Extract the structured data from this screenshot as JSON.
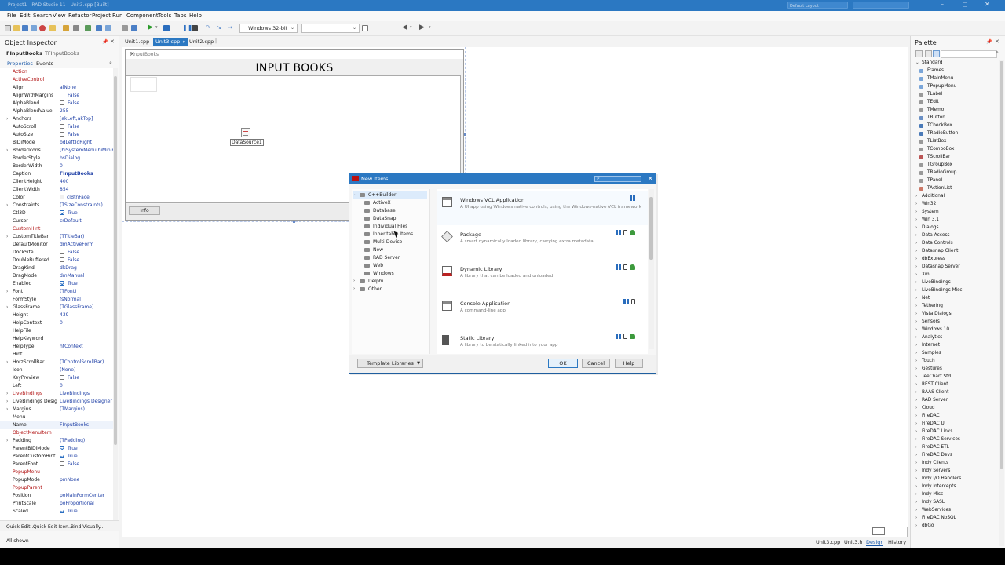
{
  "window": {
    "title": "Project1 - RAD Studio 11 - Unit3.cpp [Built]",
    "search_box": "Default Layout",
    "search2": ""
  },
  "menu": [
    "File",
    "Edit",
    "Search",
    "View",
    "Refactor",
    "Project",
    "Run",
    "Component",
    "Tools",
    "Tabs",
    "Help"
  ],
  "toolbar": {
    "platform": "Windows 32-bit",
    "config": ""
  },
  "object_inspector": {
    "title": "Object Inspector",
    "object_name": "FInputBooks",
    "object_type": "TFInputBooks",
    "tabs": [
      "Properties",
      "Events"
    ],
    "properties": [
      {
        "n": "Action",
        "v": "",
        "hl": true
      },
      {
        "n": "ActiveControl",
        "v": "",
        "hl": true
      },
      {
        "n": "Align",
        "v": "alNone"
      },
      {
        "n": "AlignWithMargins",
        "cb": false,
        "v": "False"
      },
      {
        "n": "AlphaBlend",
        "cb": false,
        "v": "False"
      },
      {
        "n": "AlphaBlendValue",
        "v": "255"
      },
      {
        "n": "Anchors",
        "v": "[akLeft,akTop]",
        "exp": true
      },
      {
        "n": "AutoScroll",
        "cb": false,
        "v": "False"
      },
      {
        "n": "AutoSize",
        "cb": false,
        "v": "False"
      },
      {
        "n": "BiDiMode",
        "v": "bdLeftToRight"
      },
      {
        "n": "BorderIcons",
        "v": "[biSystemMenu,biMinim",
        "exp": true
      },
      {
        "n": "BorderStyle",
        "v": "bsDialog"
      },
      {
        "n": "BorderWidth",
        "v": "0"
      },
      {
        "n": "Caption",
        "v": "FInputBooks",
        "b": true
      },
      {
        "n": "ClientHeight",
        "v": "400"
      },
      {
        "n": "ClientWidth",
        "v": "854"
      },
      {
        "n": "Color",
        "v": "clBtnFace",
        "sw": true
      },
      {
        "n": "Constraints",
        "v": "(TSizeConstraints)",
        "exp": true
      },
      {
        "n": "Ctl3D",
        "cb": true,
        "v": "True"
      },
      {
        "n": "Cursor",
        "v": "crDefault"
      },
      {
        "n": "CustomHint",
        "v": "",
        "hl": true
      },
      {
        "n": "CustomTitleBar",
        "v": "(TTitleBar)",
        "exp": true
      },
      {
        "n": "DefaultMonitor",
        "v": "dmActiveForm"
      },
      {
        "n": "DockSite",
        "cb": false,
        "v": "False"
      },
      {
        "n": "DoubleBuffered",
        "cb": false,
        "v": "False"
      },
      {
        "n": "DragKind",
        "v": "dkDrag"
      },
      {
        "n": "DragMode",
        "v": "dmManual"
      },
      {
        "n": "Enabled",
        "cb": true,
        "v": "True"
      },
      {
        "n": "Font",
        "v": "(TFont)",
        "exp": true
      },
      {
        "n": "FormStyle",
        "v": "fsNormal"
      },
      {
        "n": "GlassFrame",
        "v": "(TGlassFrame)",
        "exp": true
      },
      {
        "n": "Height",
        "v": "439"
      },
      {
        "n": "HelpContext",
        "v": "0"
      },
      {
        "n": "HelpFile",
        "v": ""
      },
      {
        "n": "HelpKeyword",
        "v": ""
      },
      {
        "n": "HelpType",
        "v": "htContext"
      },
      {
        "n": "Hint",
        "v": ""
      },
      {
        "n": "HorzScrollBar",
        "v": "(TControlScrollBar)",
        "exp": true
      },
      {
        "n": "Icon",
        "v": "(None)"
      },
      {
        "n": "KeyPreview",
        "cb": false,
        "v": "False"
      },
      {
        "n": "Left",
        "v": "0"
      },
      {
        "n": "LiveBindings",
        "v": "LiveBindings",
        "hl": true,
        "exp": true
      },
      {
        "n": "LiveBindings Designe",
        "v": "LiveBindings Designer",
        "exp": true
      },
      {
        "n": "Margins",
        "v": "(TMargins)",
        "exp": true
      },
      {
        "n": "Menu",
        "v": ""
      },
      {
        "n": "Name",
        "v": "FInputBooks",
        "sel": true
      },
      {
        "n": "ObjectMenuItem",
        "v": "",
        "hl": true
      },
      {
        "n": "Padding",
        "v": "(TPadding)",
        "exp": true
      },
      {
        "n": "ParentBiDiMode",
        "cb": true,
        "v": "True"
      },
      {
        "n": "ParentCustomHint",
        "cb": true,
        "v": "True"
      },
      {
        "n": "ParentFont",
        "cb": false,
        "v": "False"
      },
      {
        "n": "PopupMenu",
        "v": "",
        "hl": true
      },
      {
        "n": "PopupMode",
        "v": "pmNone"
      },
      {
        "n": "PopupParent",
        "v": "",
        "hl": true
      },
      {
        "n": "Position",
        "v": "poMainFormCenter"
      },
      {
        "n": "PrintScale",
        "v": "poProportional"
      },
      {
        "n": "Scaled",
        "cb": true,
        "v": "True"
      }
    ],
    "footer_links": [
      "Quick Edit...",
      "Quick Edit Icon...",
      "Bind Visually..."
    ],
    "status": "All shown"
  },
  "editor": {
    "tabs": [
      "Unit1.cpp",
      "Unit3.cpp",
      "Unit2.cpp"
    ],
    "active_tab": 1,
    "form_caption": "FInputBooks",
    "heading": "INPUT BOOKS",
    "datasource": "DataSource1",
    "info_button": "Info",
    "bottom_tabs": [
      "Unit3.cpp",
      "Unit3.h",
      "Design",
      "History"
    ]
  },
  "palette": {
    "title": "Palette",
    "items": [
      {
        "t": "cat",
        "l": "Standard",
        "open": true
      },
      {
        "t": "comp",
        "l": "Frames",
        "c": "#7aa5d8"
      },
      {
        "t": "comp",
        "l": "TMainMenu",
        "c": "#7aa5d8"
      },
      {
        "t": "comp",
        "l": "TPopupMenu",
        "c": "#7aa5d8"
      },
      {
        "t": "comp",
        "l": "TLabel",
        "c": "#999"
      },
      {
        "t": "comp",
        "l": "TEdit",
        "c": "#999"
      },
      {
        "t": "comp",
        "l": "TMemo",
        "c": "#999"
      },
      {
        "t": "comp",
        "l": "TButton",
        "c": "#6a8fc4"
      },
      {
        "t": "comp",
        "l": "TCheckBox",
        "c": "#4a7ab8"
      },
      {
        "t": "comp",
        "l": "TRadioButton",
        "c": "#4a7ab8"
      },
      {
        "t": "comp",
        "l": "TListBox",
        "c": "#999"
      },
      {
        "t": "comp",
        "l": "TComboBox",
        "c": "#999"
      },
      {
        "t": "comp",
        "l": "TScrollBar",
        "c": "#b55"
      },
      {
        "t": "comp",
        "l": "TGroupBox",
        "c": "#999"
      },
      {
        "t": "comp",
        "l": "TRadioGroup",
        "c": "#999"
      },
      {
        "t": "comp",
        "l": "TPanel",
        "c": "#999"
      },
      {
        "t": "comp",
        "l": "TActionList",
        "c": "#c76"
      },
      {
        "t": "cat",
        "l": "Additional"
      },
      {
        "t": "cat",
        "l": "Win32"
      },
      {
        "t": "cat",
        "l": "System"
      },
      {
        "t": "cat",
        "l": "Win 3.1"
      },
      {
        "t": "cat",
        "l": "Dialogs"
      },
      {
        "t": "cat",
        "l": "Data Access"
      },
      {
        "t": "cat",
        "l": "Data Controls"
      },
      {
        "t": "cat",
        "l": "Datasnap Client"
      },
      {
        "t": "cat",
        "l": "dbExpress"
      },
      {
        "t": "cat",
        "l": "Datasnap Server"
      },
      {
        "t": "cat",
        "l": "Xml"
      },
      {
        "t": "cat",
        "l": "LiveBindings"
      },
      {
        "t": "cat",
        "l": "LiveBindings Misc"
      },
      {
        "t": "cat",
        "l": "Net"
      },
      {
        "t": "cat",
        "l": "Tethering"
      },
      {
        "t": "cat",
        "l": "Vista Dialogs"
      },
      {
        "t": "cat",
        "l": "Sensors"
      },
      {
        "t": "cat",
        "l": "Windows 10"
      },
      {
        "t": "cat",
        "l": "Analytics"
      },
      {
        "t": "cat",
        "l": "Internet"
      },
      {
        "t": "cat",
        "l": "Samples"
      },
      {
        "t": "cat",
        "l": "Touch"
      },
      {
        "t": "cat",
        "l": "Gestures"
      },
      {
        "t": "cat",
        "l": "TeeChart Std"
      },
      {
        "t": "cat",
        "l": "REST Client"
      },
      {
        "t": "cat",
        "l": "BAAS Client"
      },
      {
        "t": "cat",
        "l": "RAD Server"
      },
      {
        "t": "cat",
        "l": "Cloud"
      },
      {
        "t": "cat",
        "l": "FireDAC"
      },
      {
        "t": "cat",
        "l": "FireDAC UI"
      },
      {
        "t": "cat",
        "l": "FireDAC Links"
      },
      {
        "t": "cat",
        "l": "FireDAC Services"
      },
      {
        "t": "cat",
        "l": "FireDAC ETL"
      },
      {
        "t": "cat",
        "l": "FireDAC Devs"
      },
      {
        "t": "cat",
        "l": "Indy Clients"
      },
      {
        "t": "cat",
        "l": "Indy Servers"
      },
      {
        "t": "cat",
        "l": "Indy I/O Handlers"
      },
      {
        "t": "cat",
        "l": "Indy Intercepts"
      },
      {
        "t": "cat",
        "l": "Indy Misc"
      },
      {
        "t": "cat",
        "l": "Indy SASL"
      },
      {
        "t": "cat",
        "l": "WebServices"
      },
      {
        "t": "cat",
        "l": "FireDAC NoSQL"
      },
      {
        "t": "cat",
        "l": "dbGo"
      }
    ]
  },
  "dialog": {
    "title": "New Items",
    "tree": [
      {
        "l": "C++Builder",
        "lvl": 0,
        "open": true,
        "sel": true
      },
      {
        "l": "ActiveX",
        "lvl": 1
      },
      {
        "l": "Database",
        "lvl": 1
      },
      {
        "l": "DataSnap",
        "lvl": 1
      },
      {
        "l": "Individual Files",
        "lvl": 1
      },
      {
        "l": "Inheritable Items",
        "lvl": 1
      },
      {
        "l": "Multi-Device",
        "lvl": 1
      },
      {
        "l": "New",
        "lvl": 1
      },
      {
        "l": "RAD Server",
        "lvl": 1
      },
      {
        "l": "Web",
        "lvl": 1
      },
      {
        "l": "Windows",
        "lvl": 1
      },
      {
        "l": "Delphi",
        "lvl": 0,
        "closed": true
      },
      {
        "l": "Other",
        "lvl": 0,
        "closed": true
      }
    ],
    "items": [
      {
        "title": "Windows VCL Application",
        "desc": "A UI app using Windows native controls, using the Windows-native VCL framework",
        "plat": [
          "win"
        ],
        "icon": "window-icon"
      },
      {
        "title": "Package",
        "desc": "A smart dynamically loaded library, carrying extra metadata",
        "plat": [
          "win",
          "mac",
          "and"
        ],
        "icon": "package-icon"
      },
      {
        "title": "Dynamic Library",
        "desc": "A library that can be loaded and unloaded",
        "plat": [
          "win",
          "mac",
          "and"
        ],
        "icon": "dll-icon"
      },
      {
        "title": "Console Application",
        "desc": "A command-line app",
        "plat": [
          "win",
          "mac"
        ],
        "icon": "console-icon"
      },
      {
        "title": "Static Library",
        "desc": "A library to be statically linked into your app",
        "plat": [
          "win",
          "mac",
          "and"
        ],
        "icon": "static-lib-icon"
      }
    ],
    "buttons": {
      "template": "Template Libraries",
      "ok": "OK",
      "cancel": "Cancel",
      "help": "Help"
    }
  }
}
